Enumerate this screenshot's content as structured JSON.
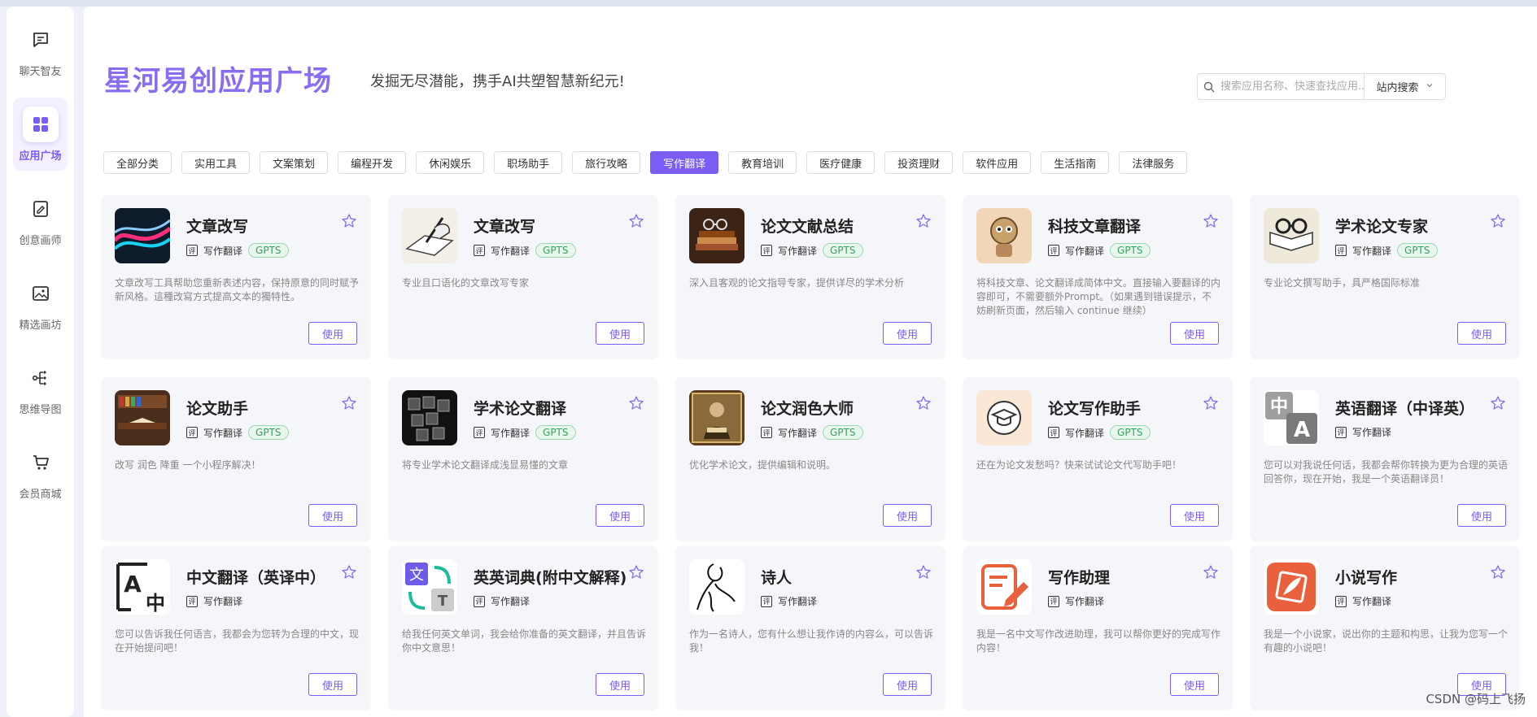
{
  "sidebar": {
    "items": [
      {
        "label": "聊天智友",
        "icon": "chat-icon",
        "active": false
      },
      {
        "label": "应用广场",
        "icon": "apps-grid-icon",
        "active": true
      },
      {
        "label": "创意画师",
        "icon": "draw-icon",
        "active": false
      },
      {
        "label": "精选画坊",
        "icon": "gallery-icon",
        "active": false
      },
      {
        "label": "思维导图",
        "icon": "mindmap-icon",
        "active": false
      },
      {
        "label": "会员商城",
        "icon": "cart-icon",
        "active": false
      }
    ]
  },
  "header": {
    "title": "星河易创应用广场",
    "subtitle": "发掘无尽潜能，携手AI共塑智慧新纪元!"
  },
  "search": {
    "placeholder": "搜索应用名称、快速查找应用...",
    "scope": "站内搜索"
  },
  "categories": [
    {
      "label": "全部分类",
      "active": false
    },
    {
      "label": "实用工具",
      "active": false
    },
    {
      "label": "文案策划",
      "active": false
    },
    {
      "label": "编程开发",
      "active": false
    },
    {
      "label": "休闲娱乐",
      "active": false
    },
    {
      "label": "职场助手",
      "active": false
    },
    {
      "label": "旅行攻略",
      "active": false
    },
    {
      "label": "写作翻译",
      "active": true
    },
    {
      "label": "教育培训",
      "active": false
    },
    {
      "label": "医疗健康",
      "active": false
    },
    {
      "label": "投资理财",
      "active": false
    },
    {
      "label": "软件应用",
      "active": false
    },
    {
      "label": "生活指南",
      "active": false
    },
    {
      "label": "法律服务",
      "active": false
    }
  ],
  "card_common": {
    "meta_icon": "评",
    "category": "写作翻译",
    "badge": "GPTS",
    "use_label": "使用"
  },
  "apps": [
    {
      "title": "文章改写",
      "desc": "文章改写工具帮助您重新表述内容，保持原意的同时赋予新风格。這種改寫方式提高文本的獨特性。",
      "gpts": true,
      "icon": "neon-waves-icon"
    },
    {
      "title": "文章改写",
      "desc": "专业且口语化的文章改写专家",
      "gpts": true,
      "icon": "writing-hand-icon"
    },
    {
      "title": "论文文献总结",
      "desc": "深入且客观的论文指导专家，提供详尽的学术分析",
      "gpts": true,
      "icon": "books-glasses-icon"
    },
    {
      "title": "科技文章翻译",
      "desc": "将科技文章、论文翻译成简体中文。直接输入要翻译的内容即可，不需要额外Prompt。（如果遇到错误提示，不妨刷新页面，然后输入 continue 继续）",
      "gpts": true,
      "icon": "robot-mascot-icon"
    },
    {
      "title": "学术论文专家",
      "desc": "专业论文撰写助手，具严格国际标准",
      "gpts": true,
      "icon": "glasses-book-icon"
    },
    {
      "title": "论文助手",
      "desc": "改写 润色 降重 一个小程序解决！",
      "gpts": true,
      "icon": "library-icon"
    },
    {
      "title": "学术论文翻译",
      "desc": "将专业学术论文翻译成浅显易懂的文章",
      "gpts": true,
      "icon": "scrabble-tiles-icon"
    },
    {
      "title": "论文润色大师",
      "desc": "优化学术论文，提供编辑和说明。",
      "gpts": true,
      "icon": "scholar-painting-icon"
    },
    {
      "title": "论文写作助手",
      "desc": "还在为论文发愁吗？快来试试论文代写助手吧！",
      "gpts": true,
      "icon": "graduation-cap-icon"
    },
    {
      "title": "英语翻译（中译英）",
      "desc": "您可以对我说任何话，我都会帮你转换为更为合理的英语回答你，现在开始，我是一个英语翻译员！",
      "gpts": false,
      "icon": "zh-to-en-icon"
    },
    {
      "title": "中文翻译（英译中）",
      "desc": "您可以告诉我任何语言，我都会为您转为合理的中文，现在开始提问吧！",
      "gpts": false,
      "icon": "en-to-zh-icon"
    },
    {
      "title": "英英词典(附中文解释)",
      "desc": "给我任何英文单词，我会给你准备的英文翻译，并且告诉你中文意思！",
      "gpts": false,
      "icon": "dictionary-translate-icon"
    },
    {
      "title": "诗人",
      "desc": "作为一名诗人，您有什么想让我作诗的内容么，可以告诉我！",
      "gpts": false,
      "icon": "poet-sketch-icon"
    },
    {
      "title": "写作助理",
      "desc": "我是一名中文写作改进助理，我可以帮你更好的完成写作内容！",
      "gpts": false,
      "icon": "edit-note-icon"
    },
    {
      "title": "小说写作",
      "desc": "我是一个小说家，说出你的主题和构思，让我为您写一个有趣的小说吧！",
      "gpts": false,
      "icon": "novel-icon"
    }
  ],
  "watermark": "CSDN @码上飞扬"
}
